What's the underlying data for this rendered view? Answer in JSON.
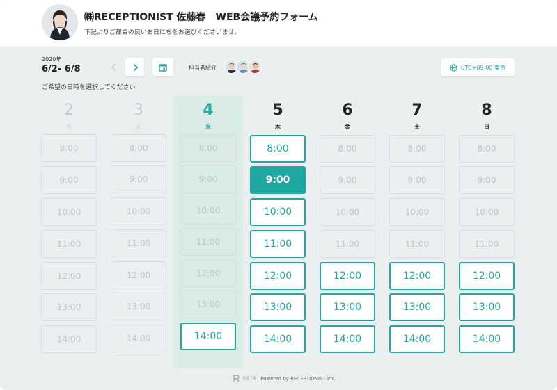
{
  "header": {
    "title": "㈱RECEPTIONIST 佐藤春　WEB会議予約フォーム",
    "subtitle": "下記よりご都合の良いお日にちをお選びくださいませ。"
  },
  "toolbar": {
    "year": "2020年",
    "range": "6/2- 6/8",
    "staff_label": "担当者紹介",
    "timezone": "UTC+09:00 東京",
    "instruction": "ご希望の日時を選択してください"
  },
  "days": [
    {
      "num": "2",
      "weekday": "月"
    },
    {
      "num": "3",
      "weekday": "火"
    },
    {
      "num": "4",
      "weekday": "水"
    },
    {
      "num": "5",
      "weekday": "木"
    },
    {
      "num": "6",
      "weekday": "金"
    },
    {
      "num": "7",
      "weekday": "土"
    },
    {
      "num": "8",
      "weekday": "日"
    }
  ],
  "slots": {
    "d0": [
      "8:00",
      "9:00",
      "10:00",
      "11:00",
      "12:00",
      "13:00",
      "14:00"
    ],
    "d1": [
      "8:00",
      "9:00",
      "10:00",
      "11:00",
      "12:00",
      "13:00",
      "14:00"
    ],
    "d2": [
      "8:00",
      "9:00",
      "10:00",
      "11:00",
      "12:00",
      "13:00",
      "14:00"
    ],
    "d3": [
      "8:00",
      "9:00",
      "10:00",
      "11:00",
      "12:00",
      "13:00",
      "14:00"
    ],
    "d4": [
      "8:00",
      "9:00",
      "10:00",
      "11:00",
      "12:00",
      "13:00",
      "14:00"
    ],
    "d5": [
      "8:00",
      "9:00",
      "10:00",
      "11:00",
      "12:00",
      "13:00",
      "14:00"
    ],
    "d6": [
      "8:00",
      "9:00",
      "10:00",
      "11:00",
      "12:00",
      "13:00",
      "14:00"
    ]
  },
  "footer": {
    "brand": "RETA",
    "powered": "Powered by RECEPTIONIST Inc."
  },
  "colors": {
    "accent": "#20a8a2",
    "today_bg": "#d9ece6",
    "background": "#eceff0"
  }
}
